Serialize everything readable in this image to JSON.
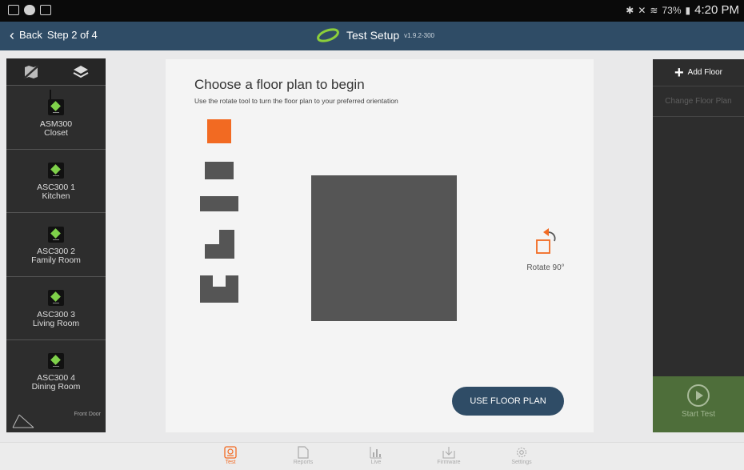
{
  "header": {
    "back_label": "Back",
    "step": "Step 2 of 4",
    "title": "Test Setup",
    "version": "v1.9.2-300"
  },
  "status": {
    "battery": "73%",
    "time": "4:20 PM"
  },
  "devices": [
    {
      "model": "ASM300",
      "location": "Closet"
    },
    {
      "model": "ASC300 1",
      "location": "Kitchen"
    },
    {
      "model": "ASC300 2",
      "location": "Family Room"
    },
    {
      "model": "ASC300 3",
      "location": "Living Room"
    },
    {
      "model": "ASC300 4",
      "location": "Dining Room"
    }
  ],
  "front_door_label": "Front Door",
  "main": {
    "heading": "Choose a floor plan to begin",
    "subtext": "Use the rotate tool to turn the floor plan to your preferred orientation",
    "rotate_label": "Rotate 90°",
    "use_button": "USE FLOOR PLAN"
  },
  "right": {
    "add_floor": "Add Floor",
    "change_floor_plan": "Change Floor Plan",
    "start_test": "Start Test"
  },
  "nav": [
    "Test",
    "Reports",
    "Live",
    "Firmware",
    "Settings"
  ],
  "colors": {
    "accent": "#f26a22",
    "appbar": "#2f4c66",
    "start": "#4e6e3a"
  }
}
